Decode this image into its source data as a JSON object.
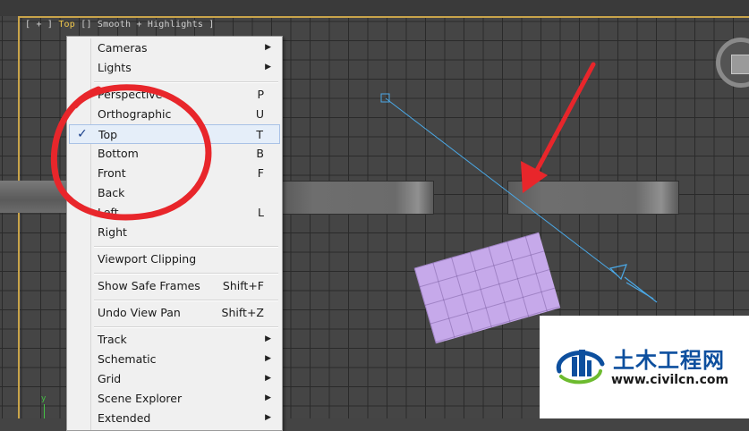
{
  "viewport": {
    "label_prefix": "[ + ] ",
    "active_view": "Top",
    "label_suffix": " [] Smooth + Highlights ]",
    "axis_y": "y"
  },
  "context_menu": {
    "items": [
      {
        "label": "Cameras",
        "shortcut": "",
        "submenu": true,
        "checked": false
      },
      {
        "label": "Lights",
        "shortcut": "",
        "submenu": true,
        "checked": false
      },
      {
        "label": "Perspective",
        "shortcut": "P",
        "submenu": false,
        "checked": false
      },
      {
        "label": "Orthographic",
        "shortcut": "U",
        "submenu": false,
        "checked": false
      },
      {
        "label": "Top",
        "shortcut": "T",
        "submenu": false,
        "checked": true
      },
      {
        "label": "Bottom",
        "shortcut": "B",
        "submenu": false,
        "checked": false
      },
      {
        "label": "Front",
        "shortcut": "F",
        "submenu": false,
        "checked": false
      },
      {
        "label": "Back",
        "shortcut": "",
        "submenu": false,
        "checked": false
      },
      {
        "label": "Left",
        "shortcut": "L",
        "submenu": false,
        "checked": false
      },
      {
        "label": "Right",
        "shortcut": "",
        "submenu": false,
        "checked": false
      },
      {
        "label": "Viewport Clipping",
        "shortcut": "",
        "submenu": false,
        "checked": false
      },
      {
        "label": "Show Safe Frames",
        "shortcut": "Shift+F",
        "submenu": false,
        "checked": false
      },
      {
        "label": "Undo View Pan",
        "shortcut": "Shift+Z",
        "submenu": false,
        "checked": false
      },
      {
        "label": "Track",
        "shortcut": "",
        "submenu": true,
        "checked": false
      },
      {
        "label": "Schematic",
        "shortcut": "",
        "submenu": true,
        "checked": false
      },
      {
        "label": "Grid",
        "shortcut": "",
        "submenu": true,
        "checked": false
      },
      {
        "label": "Scene Explorer",
        "shortcut": "",
        "submenu": true,
        "checked": false
      },
      {
        "label": "Extended",
        "shortcut": "",
        "submenu": true,
        "checked": false
      }
    ],
    "check_glyph": "✓",
    "submenu_glyph": "▶"
  },
  "watermark": {
    "title": "土木工程网",
    "url": "www.civilcn.com"
  },
  "colors": {
    "annotation_red": "#e8262b",
    "selection_highlight": "#e5eef9",
    "plane_purple": "#c6a9ea",
    "viewport_label_active": "#f2c94c",
    "logo_blue": "#0d4f9e",
    "logo_green": "#6dbb2f"
  },
  "icons": {
    "check": "checkmark-icon",
    "submenu": "submenu-arrow-icon",
    "viewcube": "viewcube-icon",
    "logo": "civilcn-logo-icon"
  }
}
